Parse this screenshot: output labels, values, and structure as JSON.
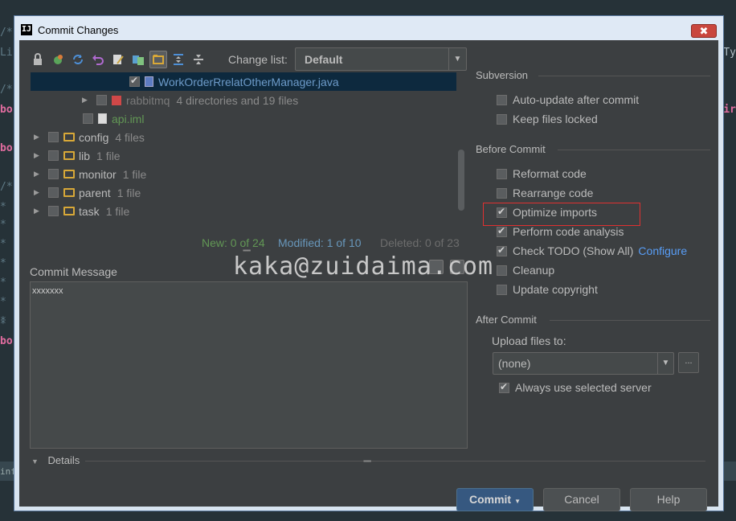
{
  "background": {
    "left_lines": [
      "/*",
      "Li",
      "/*",
      "bo",
      "bo",
      "/*",
      "*",
      "*",
      "*",
      "*",
      "*",
      "*",
      "*",
      "*",
      "bo",
      "info"
    ],
    "right_lines": [
      "Ty",
      "ir"
    ]
  },
  "dialog": {
    "title": "Commit Changes",
    "title_icon": "IJ",
    "close_label": "✖"
  },
  "toolbar": {
    "icons": [
      "lock-icon",
      "move-icon",
      "refresh-icon",
      "undo-icon",
      "edit-icon",
      "diff-icon",
      "group-icon",
      "expand-icon",
      "collapse-icon"
    ],
    "changelist_label": "Change list:",
    "changelist_value": "Default"
  },
  "tree": {
    "rows": [
      {
        "name": "WorkOrderRrelatOtherManager.java",
        "meta": "",
        "checked": true,
        "selected": true
      },
      {
        "name": "rabbitmq",
        "meta": "4 directories and 19 files",
        "checked": false,
        "selected": false
      },
      {
        "name": "api.iml",
        "meta": "",
        "checked": false,
        "selected": false
      },
      {
        "name": "config",
        "meta": "4 files",
        "checked": false,
        "selected": false
      },
      {
        "name": "lib",
        "meta": "1 file",
        "checked": false,
        "selected": false
      },
      {
        "name": "monitor",
        "meta": "1 file",
        "checked": false,
        "selected": false
      },
      {
        "name": "parent",
        "meta": "1 file",
        "checked": false,
        "selected": false
      },
      {
        "name": "task",
        "meta": "1 file",
        "checked": false,
        "selected": false
      }
    ]
  },
  "stats": {
    "new": "New: 0 of 24",
    "modified": "Modified: 1 of 10",
    "deleted": "Deleted: 0 of 23"
  },
  "commit_message": {
    "label": "Commit Message",
    "text": "xxxxxxx"
  },
  "watermark": "kaka@zuidaima.com",
  "details_label": "Details",
  "subversion": {
    "title": "Subversion",
    "auto_update": {
      "label": "Auto-update after commit",
      "checked": false
    },
    "keep_locked": {
      "label": "Keep files locked",
      "checked": false
    }
  },
  "before_commit": {
    "title": "Before Commit",
    "reformat": {
      "label": "Reformat code",
      "checked": false
    },
    "rearrange": {
      "label": "Rearrange code",
      "checked": false
    },
    "optimize": {
      "label": "Optimize imports",
      "checked": true
    },
    "analysis": {
      "label": "Perform code analysis",
      "checked": true
    },
    "todo": {
      "label": "Check TODO (Show All)",
      "checked": true,
      "link": "Configure"
    },
    "cleanup": {
      "label": "Cleanup",
      "checked": false
    },
    "copyright": {
      "label": "Update copyright",
      "checked": false
    }
  },
  "after_commit": {
    "title": "After Commit",
    "upload_label": "Upload files to:",
    "upload_value": "(none)",
    "browse_label": "...",
    "always_use": {
      "label": "Always use selected server",
      "checked": true
    }
  },
  "buttons": {
    "commit": "Commit",
    "cancel": "Cancel",
    "help": "Help"
  },
  "colors": {
    "dialog_bg": "#3c3f41",
    "accent": "#365880",
    "link": "#589df6",
    "highlight_box": "#e03030"
  }
}
